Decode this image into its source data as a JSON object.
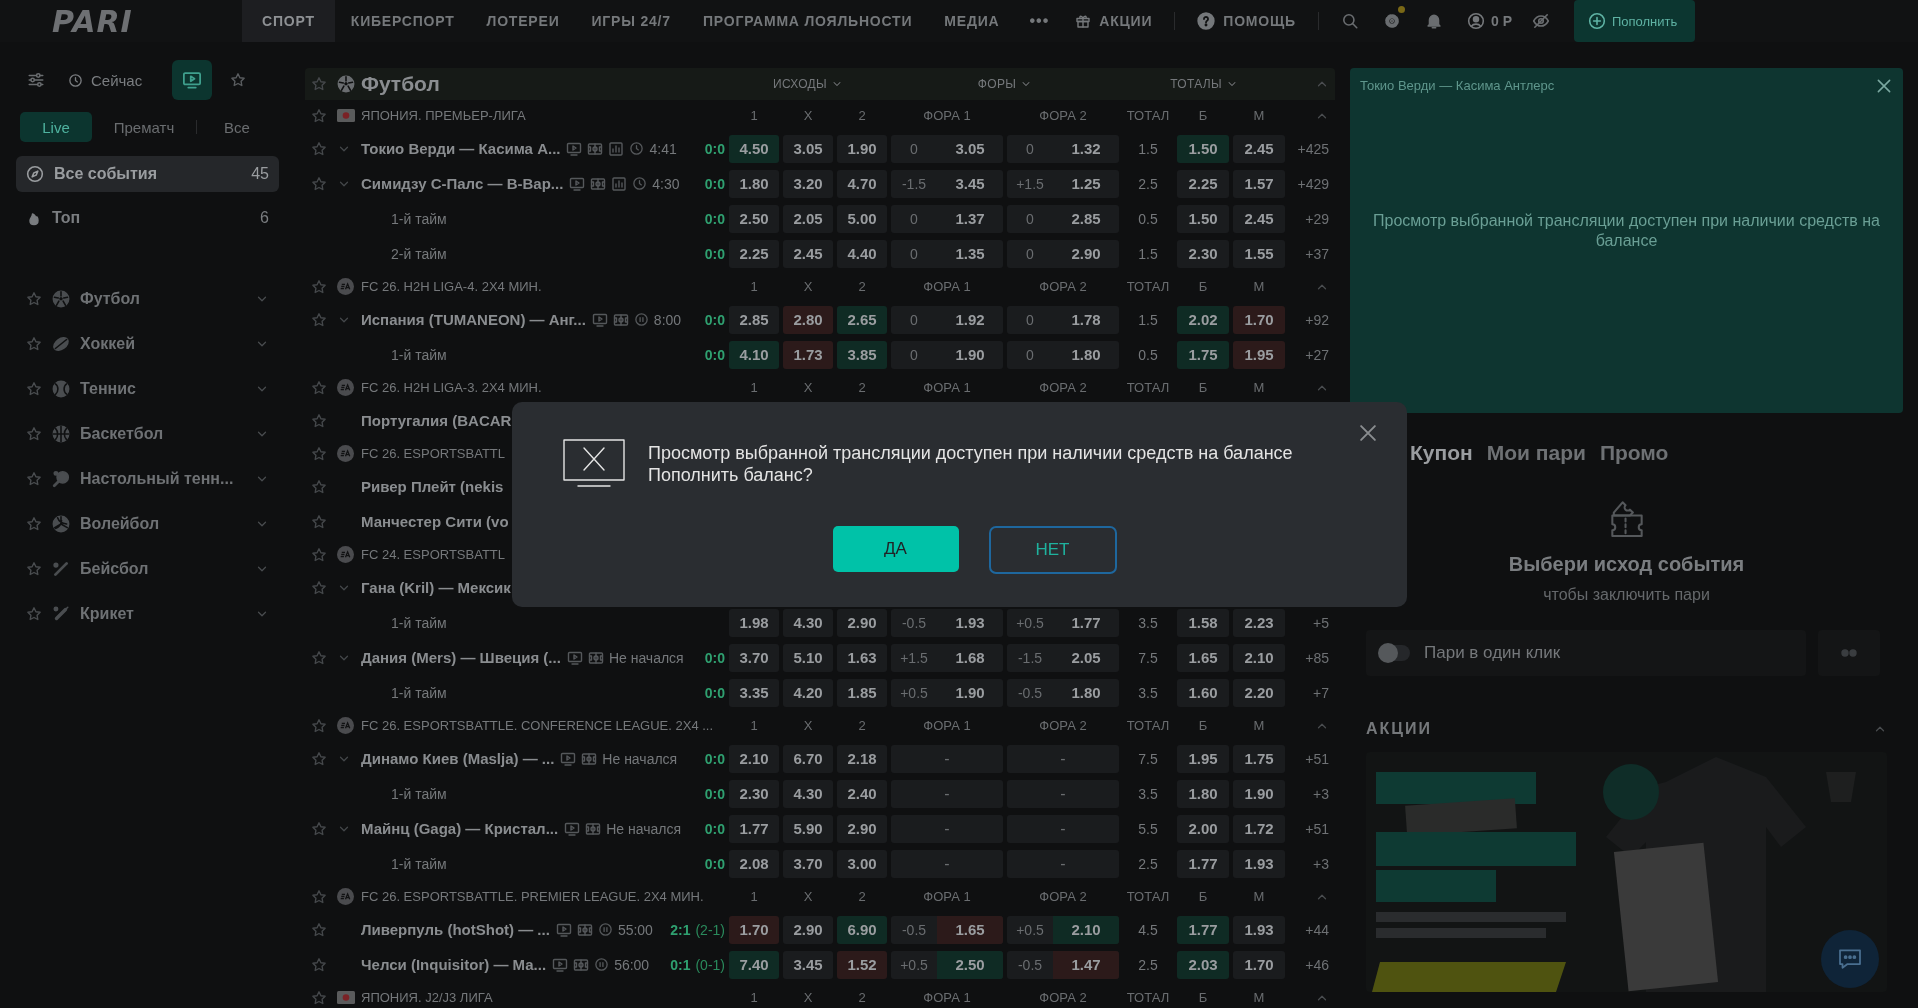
{
  "header": {
    "logo": "PARI",
    "nav": [
      {
        "label": "СПОРТ",
        "selected": true
      },
      {
        "label": "КИБЕРСПОРТ",
        "selected": false
      },
      {
        "label": "ЛОТЕРЕИ",
        "selected": false
      },
      {
        "label": "ИГРЫ 24/7",
        "selected": false
      },
      {
        "label": "ПРОГРАММА ЛОЯЛЬНОСТИ",
        "selected": false
      },
      {
        "label": "МЕДИА",
        "selected": false
      }
    ],
    "more": "•••",
    "promotions": "АКЦИИ",
    "help": "ПОМОЩЬ",
    "notification": true,
    "balance": "0 Р",
    "deposit": "Пополнить"
  },
  "sidebar": {
    "now": "Сейчас",
    "stream_filter_on": true,
    "tabs": [
      {
        "label": "Live",
        "selected": true
      },
      {
        "label": "Прематч",
        "selected": false
      },
      {
        "label": "Все",
        "selected": false
      }
    ],
    "summary": [
      {
        "kind": "all",
        "label": "Все события",
        "count": "45",
        "selected": true
      },
      {
        "kind": "top",
        "label": "Топ",
        "count": "6",
        "selected": false
      }
    ],
    "sports": [
      {
        "kind": "football",
        "label": "Футбол"
      },
      {
        "kind": "hockey",
        "label": "Хоккей"
      },
      {
        "kind": "tennis",
        "label": "Теннис"
      },
      {
        "kind": "basketball",
        "label": "Баскетбол"
      },
      {
        "kind": "table_tennis",
        "label": "Настольный тенн..."
      },
      {
        "kind": "volleyball",
        "label": "Волейбол"
      },
      {
        "kind": "baseball",
        "label": "Бейсбол"
      },
      {
        "kind": "cricket",
        "label": "Крикет"
      }
    ]
  },
  "events": {
    "sport": "Футбол",
    "groups": [
      "ИСХОДЫ",
      "ФОРЫ",
      "ТОТАЛЫ"
    ],
    "blocks": [
      {
        "league": "ЯПОНИЯ. ПРЕМЬЕР-ЛИГА",
        "kind": "flag",
        "columns": [
          "1",
          "X",
          "2",
          "ФОРА 1",
          "ФОРА 2",
          "ТОТАЛ",
          "Б",
          "М"
        ],
        "rows": [
          {
            "kind": "match",
            "name": "Токио Верди — Касима А...",
            "expandable": true,
            "stats": true,
            "paused": false,
            "time": "4:41",
            "score": "0:0",
            "odds": [
              {
                "value": "4.50",
                "color": "#0f2b24"
              },
              {
                "value": "3.05"
              },
              {
                "value": "1.90"
              }
            ],
            "handicap1": {
              "line": "0",
              "value": "3.05"
            },
            "handicap2": {
              "line": "0",
              "value": "1.32"
            },
            "total": "1.5",
            "over": {
              "value": "1.50",
              "color": "#0f2b24"
            },
            "under": {
              "value": "2.45"
            },
            "more": "+425"
          },
          {
            "kind": "match",
            "name": "Симидзу С-Палс — В-Вар...",
            "expandable": true,
            "stats": true,
            "paused": false,
            "time": "4:30",
            "score": "0:0",
            "odds": [
              {
                "value": "1.80"
              },
              {
                "value": "3.20"
              },
              {
                "value": "4.70"
              }
            ],
            "handicap1": {
              "line": "-1.5",
              "value": "3.45"
            },
            "handicap2": {
              "line": "+1.5",
              "value": "1.25"
            },
            "total": "2.5",
            "over": {
              "value": "2.25"
            },
            "under": {
              "value": "1.57"
            },
            "more": "+429"
          },
          {
            "kind": "period",
            "name": "1-й тайм",
            "score": "0:0",
            "odds": [
              {
                "value": "2.50"
              },
              {
                "value": "2.05"
              },
              {
                "value": "5.00"
              }
            ],
            "handicap1": {
              "line": "0",
              "value": "1.37"
            },
            "handicap2": {
              "line": "0",
              "value": "2.85"
            },
            "total": "0.5",
            "over": {
              "value": "1.50"
            },
            "under": {
              "value": "2.45"
            },
            "more": "+29"
          },
          {
            "kind": "period",
            "name": "2-й тайм",
            "score": "0:0",
            "odds": [
              {
                "value": "2.25"
              },
              {
                "value": "2.45"
              },
              {
                "value": "4.40"
              }
            ],
            "handicap1": {
              "line": "0",
              "value": "1.35"
            },
            "handicap2": {
              "line": "0",
              "value": "2.90"
            },
            "total": "1.5",
            "over": {
              "value": "2.30"
            },
            "under": {
              "value": "1.55"
            },
            "more": "+37"
          }
        ]
      },
      {
        "league": "FC 26. H2H LIGA-4. 2X4 МИН.",
        "kind": "ea",
        "columns": [
          "1",
          "X",
          "2",
          "ФОРА 1",
          "ФОРА 2",
          "ТОТАЛ",
          "Б",
          "М"
        ],
        "rows": [
          {
            "kind": "match",
            "name": "Испания (TUMANEON) — Анг...",
            "expandable": true,
            "stats": false,
            "paused": true,
            "time": "8:00",
            "score": "0:0",
            "odds": [
              {
                "value": "2.85"
              },
              {
                "value": "2.80",
                "color": "#2c1a1a"
              },
              {
                "value": "2.65",
                "color": "#0f2b24"
              }
            ],
            "handicap1": {
              "line": "0",
              "value": "1.92"
            },
            "handicap2": {
              "line": "0",
              "value": "1.78"
            },
            "total": "1.5",
            "over": {
              "value": "2.02",
              "color": "#0f2b24"
            },
            "under": {
              "value": "1.70",
              "color": "#2c1a1a"
            },
            "more": "+92"
          },
          {
            "kind": "period",
            "name": "1-й тайм",
            "score": "0:0",
            "odds": [
              {
                "value": "4.10",
                "color": "#0f2b24"
              },
              {
                "value": "1.73",
                "color": "#2c1a1a"
              },
              {
                "value": "3.85",
                "color": "#0f2b24"
              }
            ],
            "handicap1": {
              "line": "0",
              "value": "1.90"
            },
            "handicap2": {
              "line": "0",
              "value": "1.80"
            },
            "total": "0.5",
            "over": {
              "value": "1.75",
              "color": "#0f2b24"
            },
            "under": {
              "value": "1.95",
              "color": "#2c1a1a"
            },
            "more": "+27"
          }
        ]
      },
      {
        "league": "FC 26. H2H LIGA-3. 2X4 МИН.",
        "kind": "ea",
        "columns": [
          "1",
          "X",
          "2",
          "ФОРА 1",
          "ФОРА 2",
          "ТОТАЛ",
          "Б",
          "М"
        ],
        "rows": [
          {
            "kind": "match",
            "name": "Португалия (BACAR",
            "expandable": false
          }
        ]
      },
      {
        "league": "FC 26. ESPORTSBATTL",
        "kind": "ea",
        "rows": [
          {
            "kind": "match",
            "name": "Ривер Плейт (nekis",
            "expandable": false
          },
          {
            "kind": "match",
            "name": "Манчестер Сити (vo",
            "expandable": false
          }
        ]
      },
      {
        "league": "FC 24. ESPORTSBATTL",
        "kind": "ea",
        "rows": [
          {
            "kind": "match",
            "name": "Гана (Kril) — Мексик",
            "expandable": true
          },
          {
            "kind": "period",
            "name": "1-й тайм",
            "odds": [
              {
                "value": "1.98"
              },
              {
                "value": "4.30"
              },
              {
                "value": "2.90"
              }
            ],
            "handicap1": {
              "line": "-0.5",
              "value": "1.93"
            },
            "handicap2": {
              "line": "+0.5",
              "value": "1.77"
            },
            "total": "3.5",
            "over": {
              "value": "1.58"
            },
            "under": {
              "value": "2.23"
            },
            "more": "+5"
          },
          {
            "kind": "match",
            "name": "Дания (Mers) — Швеция (...",
            "expandable": true,
            "stats": false,
            "status": "Не начался",
            "score": "0:0",
            "odds": [
              {
                "value": "3.70"
              },
              {
                "value": "5.10"
              },
              {
                "value": "1.63"
              }
            ],
            "handicap1": {
              "line": "+1.5",
              "value": "1.68"
            },
            "handicap2": {
              "line": "-1.5",
              "value": "2.05"
            },
            "total": "7.5",
            "over": {
              "value": "1.65"
            },
            "under": {
              "value": "2.10"
            },
            "more": "+85"
          },
          {
            "kind": "period",
            "name": "1-й тайм",
            "score": "0:0",
            "odds": [
              {
                "value": "3.35"
              },
              {
                "value": "4.20"
              },
              {
                "value": "1.85"
              }
            ],
            "handicap1": {
              "line": "+0.5",
              "value": "1.90"
            },
            "handicap2": {
              "line": "-0.5",
              "value": "1.80"
            },
            "total": "3.5",
            "over": {
              "value": "1.60"
            },
            "under": {
              "value": "2.20"
            },
            "more": "+7"
          }
        ]
      },
      {
        "league": "FC 26. ESPORTSBATTLE. CONFERENCE LEAGUE. 2X4 ...",
        "kind": "ea",
        "columns": [
          "1",
          "X",
          "2",
          "ФОРА 1",
          "ФОРА 2",
          "ТОТАЛ",
          "Б",
          "М"
        ],
        "rows": [
          {
            "kind": "match",
            "name": "Динамо Киев (Maslja) — ...",
            "expandable": true,
            "stats": false,
            "status": "Не начался",
            "score": "0:0",
            "odds": [
              {
                "value": "2.10"
              },
              {
                "value": "6.70"
              },
              {
                "value": "2.18"
              }
            ],
            "handicap1": {
              "value": "-"
            },
            "handicap2": {
              "value": "-"
            },
            "total": "7.5",
            "over": {
              "value": "1.95"
            },
            "under": {
              "value": "1.75"
            },
            "more": "+51"
          },
          {
            "kind": "period",
            "name": "1-й тайм",
            "score": "0:0",
            "odds": [
              {
                "value": "2.30"
              },
              {
                "value": "4.30"
              },
              {
                "value": "2.40"
              }
            ],
            "handicap1": {
              "value": "-"
            },
            "handicap2": {
              "value": "-"
            },
            "total": "3.5",
            "over": {
              "value": "1.80"
            },
            "under": {
              "value": "1.90"
            },
            "more": "+3"
          },
          {
            "kind": "match",
            "name": "Майнц (Gaga) — Кристал...",
            "expandable": true,
            "stats": false,
            "status": "Не начался",
            "score": "0:0",
            "odds": [
              {
                "value": "1.77"
              },
              {
                "value": "5.90"
              },
              {
                "value": "2.90"
              }
            ],
            "handicap1": {
              "value": "-"
            },
            "handicap2": {
              "value": "-"
            },
            "total": "5.5",
            "over": {
              "value": "2.00"
            },
            "under": {
              "value": "1.72"
            },
            "more": "+51"
          },
          {
            "kind": "period",
            "name": "1-й тайм",
            "score": "0:0",
            "odds": [
              {
                "value": "2.08"
              },
              {
                "value": "3.70"
              },
              {
                "value": "3.00"
              }
            ],
            "handicap1": {
              "value": "-"
            },
            "handicap2": {
              "value": "-"
            },
            "total": "2.5",
            "over": {
              "value": "1.77"
            },
            "under": {
              "value": "1.93"
            },
            "more": "+3"
          }
        ]
      },
      {
        "league": "FC 26. ESPORTSBATTLE. PREMIER LEAGUE. 2X4 МИН.",
        "kind": "ea",
        "columns": [
          "1",
          "X",
          "2",
          "ФОРА 1",
          "ФОРА 2",
          "ТОТАЛ",
          "Б",
          "М"
        ],
        "rows": [
          {
            "kind": "match",
            "name": "Ливерпуль (hotShot) — ...",
            "expandable": false,
            "stats": false,
            "paused": true,
            "time": "55:00",
            "score": "2:1",
            "score_detail": "(2-1)",
            "odds": [
              {
                "value": "1.70",
                "color": "#2c1a1a"
              },
              {
                "value": "2.90"
              },
              {
                "value": "6.90",
                "color": "#0f2b24"
              }
            ],
            "handicap1": {
              "line": "-0.5",
              "value": "1.65",
              "color": "#2c1a1a"
            },
            "handicap2": {
              "line": "+0.5",
              "value": "2.10",
              "color": "#0f2b24"
            },
            "total": "4.5",
            "over": {
              "value": "1.77",
              "color": "#0f2b24"
            },
            "under": {
              "value": "1.93"
            },
            "more": "+44"
          },
          {
            "kind": "match",
            "name": "Челси (Inquisitor) — Ма...",
            "expandable": false,
            "stats": false,
            "paused": true,
            "time": "56:00",
            "score": "0:1",
            "score_detail": "(0-1)",
            "odds": [
              {
                "value": "7.40",
                "color": "#0f2b24"
              },
              {
                "value": "3.45"
              },
              {
                "value": "1.52",
                "color": "#2c1a1a"
              }
            ],
            "handicap1": {
              "line": "+0.5",
              "value": "2.50",
              "color": "#0f2b24"
            },
            "handicap2": {
              "line": "-0.5",
              "value": "1.47",
              "color": "#2c1a1a"
            },
            "total": "2.5",
            "over": {
              "value": "2.03",
              "color": "#0f2b24"
            },
            "under": {
              "value": "1.70"
            },
            "more": "+46"
          }
        ]
      },
      {
        "league": "ЯПОНИЯ. J2/J3 ЛИГА",
        "kind": "flag",
        "columns": [
          "1",
          "X",
          "2",
          "ФОРА 1",
          "ФОРА 2",
          "ТОТАЛ",
          "Б",
          "М"
        ]
      }
    ]
  },
  "aside": {
    "stream": {
      "title": "Токио Верди — Касима Антлерс",
      "message": "Просмотр выбранной трансляции доступен при наличии средств на балансе"
    },
    "tabs": [
      {
        "label": "Купон",
        "selected": true
      },
      {
        "label": "Мои пари",
        "selected": false
      },
      {
        "label": "Промо",
        "selected": false
      }
    ],
    "empty": {
      "title": "Выбери исход события",
      "subtitle": "чтобы заключить пари"
    },
    "one_click": {
      "label": "Пари в один клик",
      "on": false
    },
    "promotions": {
      "title": "АКЦИИ",
      "expanded": true
    }
  },
  "modal": {
    "message": "Просмотр выбранной трансляции доступен при наличии средств на балансе",
    "question": "Пополнить баланс?",
    "confirm": "ДА",
    "cancel": "НЕТ"
  }
}
